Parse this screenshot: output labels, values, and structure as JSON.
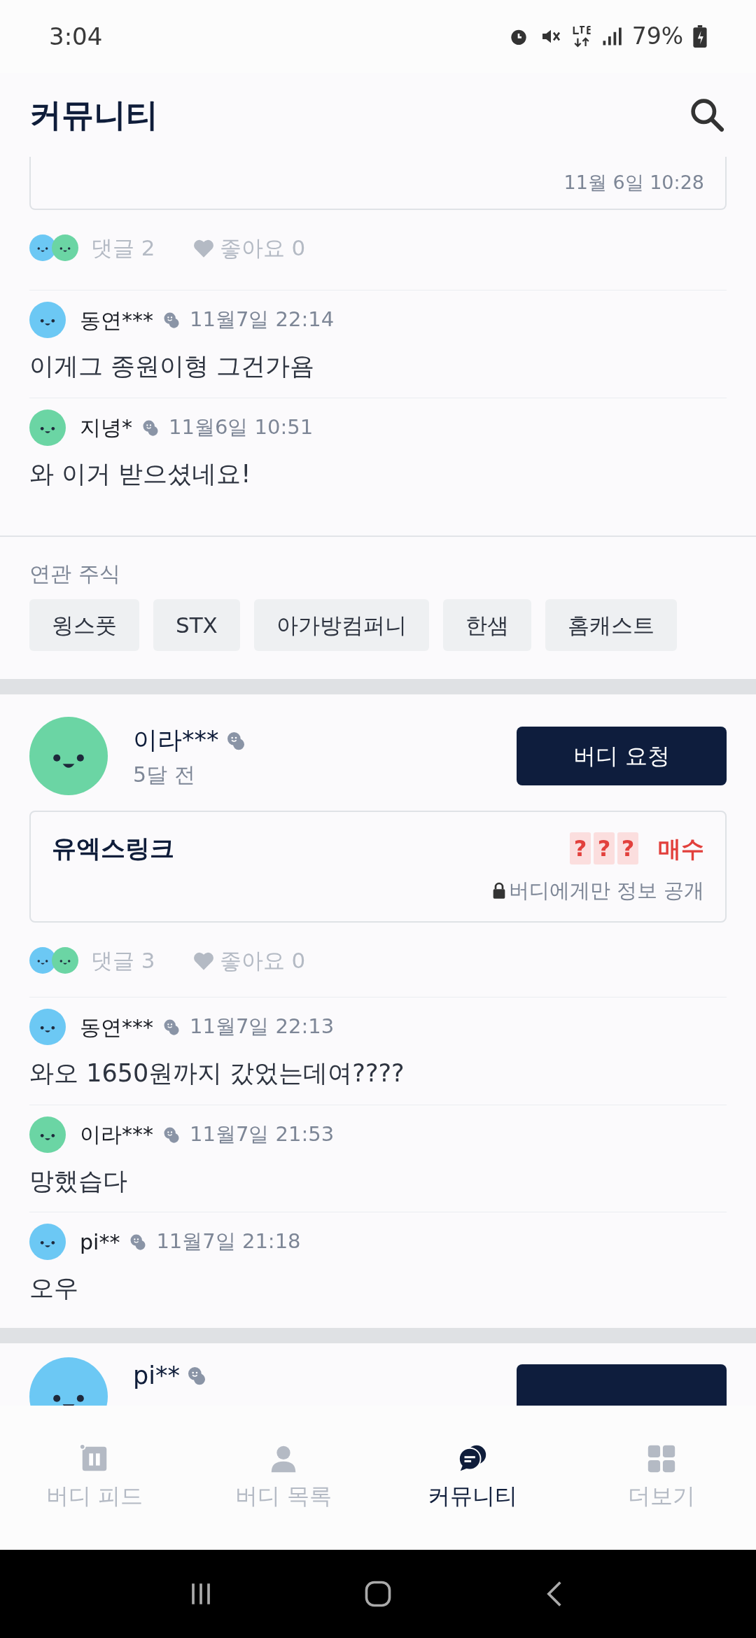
{
  "status_bar": {
    "time": "3:04",
    "battery": "79%"
  },
  "header": {
    "title": "커뮤니티"
  },
  "post_top": {
    "card_date": "11월 6일 10:28",
    "reactions": {
      "avatars": [
        {
          "color": "#6cc8f4"
        },
        {
          "color": "#6bd5a4"
        }
      ],
      "comments": "댓글 2",
      "likes": "좋아요 0"
    },
    "comments": [
      {
        "name": "동연***",
        "color": "#6cc8f4",
        "time": "11월7일 22:14",
        "text": "이게그 종원이형 그건가욤"
      },
      {
        "name": "지녕*",
        "color": "#6bd5a4",
        "time": "11월6일 10:51",
        "text": "와 이거 받으셨네요!"
      }
    ],
    "related": {
      "label": "연관 주식",
      "stocks": [
        "윙스풋",
        "STX",
        "아가방컴퍼니",
        "한샘",
        "홈캐스트"
      ]
    }
  },
  "post": {
    "author": {
      "name": "이라***",
      "color": "#6bd5a4",
      "time": "5달 전"
    },
    "button": "버디 요청",
    "card": {
      "stock": "유엑스링크",
      "masked": [
        "?",
        "?",
        "?"
      ],
      "action": "매수",
      "note": "버디에게만 정보 공개"
    },
    "reactions": {
      "avatars": [
        {
          "color": "#6cc8f4"
        },
        {
          "color": "#6bd5a4"
        }
      ],
      "comments": "댓글 3",
      "likes": "좋아요 0"
    },
    "comments": [
      {
        "name": "동연***",
        "color": "#6cc8f4",
        "time": "11월7일 22:13",
        "text": "와오 1650원까지 갔었는데여????"
      },
      {
        "name": "이라***",
        "color": "#6bd5a4",
        "time": "11월7일 21:53",
        "text": "망했습다"
      },
      {
        "name": "pi**",
        "color": "#6cc8f4",
        "time": "11월7일 21:18",
        "text": "오우"
      }
    ]
  },
  "post_partial": {
    "author": {
      "name": "pi**",
      "color": "#6cc8f4"
    }
  },
  "bottom_nav": [
    {
      "kind": "feed",
      "label": "버디 피드",
      "selected": false
    },
    {
      "kind": "person",
      "label": "버디 목록",
      "selected": false
    },
    {
      "kind": "chat",
      "label": "커뮤니티",
      "selected": true
    },
    {
      "kind": "grid",
      "label": "더보기",
      "selected": false
    }
  ]
}
